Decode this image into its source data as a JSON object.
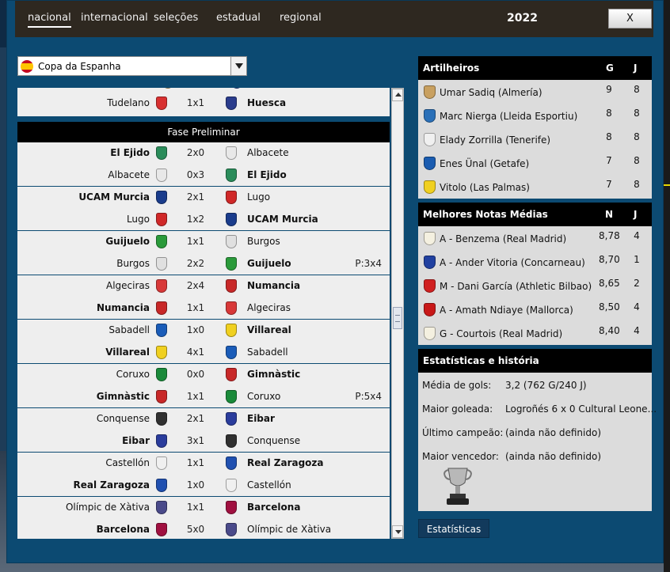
{
  "tabs": [
    "nacional",
    "internacional",
    "seleções",
    "estadual",
    "regional"
  ],
  "year": "2022",
  "close_label": "X",
  "competition": "Copa da Espanha",
  "prev_match": {
    "home": "Tudelano",
    "score": "1x1",
    "away": "Huesca"
  },
  "round_title": "Fase Preliminar",
  "matches": [
    {
      "home": "El Ejido",
      "score": "2x0",
      "away": "Albacete",
      "winner": "home"
    },
    {
      "home": "Albacete",
      "score": "0x3",
      "away": "El Ejido",
      "winner": "away"
    },
    {
      "home": "UCAM Murcia",
      "score": "2x1",
      "away": "Lugo",
      "winner": "home"
    },
    {
      "home": "Lugo",
      "score": "1x2",
      "away": "UCAM Murcia",
      "winner": "away"
    },
    {
      "home": "Guijuelo",
      "score": "1x1",
      "away": "Burgos",
      "winner": "home"
    },
    {
      "home": "Burgos",
      "score": "2x2",
      "away": "Guijuelo",
      "winner": "away",
      "note": "P:3x4"
    },
    {
      "home": "Algeciras",
      "score": "2x4",
      "away": "Numancia",
      "winner": "away"
    },
    {
      "home": "Numancia",
      "score": "1x1",
      "away": "Algeciras",
      "winner": "home"
    },
    {
      "home": "Sabadell",
      "score": "1x0",
      "away": "Villareal",
      "winner": "away"
    },
    {
      "home": "Villareal",
      "score": "4x1",
      "away": "Sabadell",
      "winner": "home"
    },
    {
      "home": "Coruxo",
      "score": "0x0",
      "away": "Gimnàstic",
      "winner": "away"
    },
    {
      "home": "Gimnàstic",
      "score": "1x1",
      "away": "Coruxo",
      "winner": "home",
      "note": "P:5x4"
    },
    {
      "home": "Conquense",
      "score": "2x1",
      "away": "Eibar",
      "winner": "away"
    },
    {
      "home": "Eibar",
      "score": "3x1",
      "away": "Conquense",
      "winner": "home"
    },
    {
      "home": "Castellón",
      "score": "1x1",
      "away": "Real Zaragoza",
      "winner": "away"
    },
    {
      "home": "Real Zaragoza",
      "score": "1x0",
      "away": "Castellón",
      "winner": "home"
    },
    {
      "home": "Olímpic de Xàtiva",
      "score": "1x1",
      "away": "Barcelona",
      "winner": "away"
    },
    {
      "home": "Barcelona",
      "score": "5x0",
      "away": "Olímpic de Xàtiva",
      "winner": "home"
    }
  ],
  "scorers": {
    "title": "Artilheiros",
    "col1": "G",
    "col2": "J",
    "rows": [
      {
        "name": "Umar Sadiq (Almería)",
        "v1": "9",
        "v2": "8",
        "color": "#c8a060"
      },
      {
        "name": "Marc Nierga (Lleida Esportiu)",
        "v1": "8",
        "v2": "8",
        "color": "#2a70b8"
      },
      {
        "name": "Elady Zorrilla (Tenerife)",
        "v1": "8",
        "v2": "8",
        "color": "#f0f0f0"
      },
      {
        "name": "Enes Ünal (Getafe)",
        "v1": "7",
        "v2": "8",
        "color": "#1a5cb0"
      },
      {
        "name": "Vitolo (Las Palmas)",
        "v1": "7",
        "v2": "8",
        "color": "#f0d020"
      }
    ]
  },
  "ratings": {
    "title": "Melhores Notas Médias",
    "col1": "N",
    "col2": "J",
    "rows": [
      {
        "name": "A - Benzema (Real Madrid)",
        "v1": "8,78",
        "v2": "4",
        "color": "#f4f0e0"
      },
      {
        "name": "A - Ander Vitoria (Concarneau)",
        "v1": "8,70",
        "v2": "1",
        "color": "#2040a0"
      },
      {
        "name": "M - Dani García (Athletic Bilbao)",
        "v1": "8,65",
        "v2": "2",
        "color": "#d02020"
      },
      {
        "name": "A - Amath Ndiaye (Mallorca)",
        "v1": "8,50",
        "v2": "4",
        "color": "#c81818"
      },
      {
        "name": "G - Courtois (Real Madrid)",
        "v1": "8,40",
        "v2": "4",
        "color": "#f4f0e0"
      }
    ]
  },
  "history": {
    "title": "Estatísticas e história",
    "rows": [
      {
        "label": "Média de gols:",
        "value": "3,2 (762 G/240 J)"
      },
      {
        "label": "Maior goleada:",
        "value": "Logroñés 6 x 0 Cultural Leone..."
      },
      {
        "label": "Último campeão:",
        "value": "(ainda não definido)"
      },
      {
        "label": "Maior vencedor:",
        "value": "(ainda não definido)"
      }
    ]
  },
  "stats_button": "Estatísticas",
  "crest_colors": {
    "Tudelano": "#d83030",
    "Huesca": "#2a3c8c",
    "El Ejido": "#2a8c5a",
    "Albacete": "#e8e8e8",
    "UCAM Murcia": "#1a3c8c",
    "Lugo": "#d02828",
    "Guijuelo": "#2a9a3a",
    "Burgos": "#e0e0e0",
    "Algeciras": "#d83838",
    "Numancia": "#c82828",
    "Sabadell": "#1a5cb8",
    "Villareal": "#f0d020",
    "Coruxo": "#1a8a3a",
    "Gimnàstic": "#c82828",
    "Conquense": "#303030",
    "Eibar": "#2a3c9c",
    "Castellón": "#f0f0f0",
    "Real Zaragoza": "#2050b0",
    "Olímpic de Xàtiva": "#4a4a8a",
    "Barcelona": "#a01040"
  }
}
